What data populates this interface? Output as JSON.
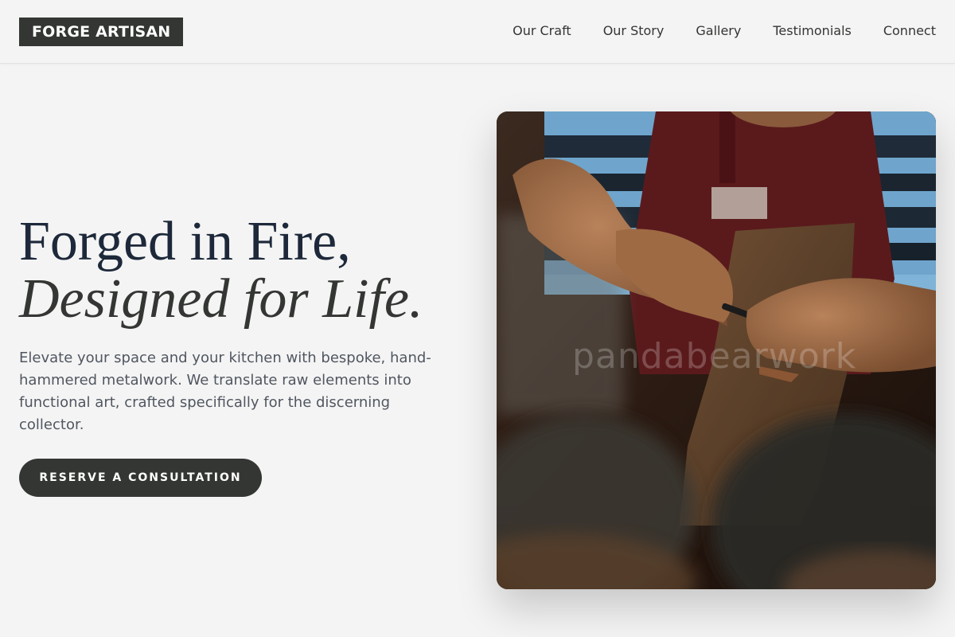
{
  "header": {
    "logo": "FORGE ARTISAN",
    "nav": [
      "Our Craft",
      "Our Story",
      "Gallery",
      "Testimonials",
      "Connect"
    ]
  },
  "hero": {
    "title_line1": "Forged in Fire,",
    "title_line2": "Designed for Life.",
    "description": "Elevate your space and your kitchen with bespoke, hand-hammered metalwork. We translate raw elements into functional art, crafted specifically for the discerning collector.",
    "cta_label": "RESERVE A CONSULTATION"
  },
  "image": {
    "watermark": "pandabearwork",
    "subject": "artisan hands working on a wooden board"
  },
  "colors": {
    "background": "#f4f4f4",
    "dark": "#333632",
    "navy": "#1d293a",
    "text_muted": "#505660"
  }
}
